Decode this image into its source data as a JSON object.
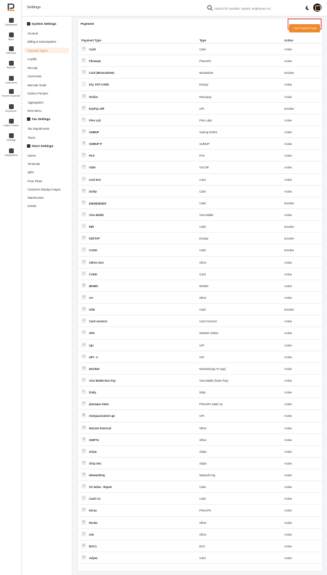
{
  "app": {
    "title": "Settings"
  },
  "rail": [
    {
      "icon": "dashboard-icon",
      "label": "Dashboard"
    },
    {
      "icon": "apps-icon",
      "label": "Apps"
    },
    {
      "icon": "inventory-icon",
      "label": "Inventory"
    },
    {
      "icon": "reports-icon",
      "label": "Reports"
    },
    {
      "icon": "customers-icon",
      "label": "Customers"
    },
    {
      "icon": "income-expense-icon",
      "label": "Income Expense"
    },
    {
      "icon": "employee-icon",
      "label": "Employee"
    },
    {
      "icon": "online-orders-icon",
      "label": "Online Orders"
    },
    {
      "icon": "settings-icon",
      "label": "Settings"
    },
    {
      "icon": "integrations-icon",
      "label": "Integrations"
    }
  ],
  "search": {
    "placeholder": "Search for modules, reports, employees etc..."
  },
  "menu": {
    "system_title": "System Settings",
    "system_items": [
      "General",
      "Billing & Subscriptions",
      "Payment Types",
      "Loyalty",
      "Receipt",
      "Currencies",
      "Barcode Scale",
      "Kitchen Printers",
      "Aggregators",
      "Item Menu"
    ],
    "tax_title": "Tax Settings",
    "tax_items": [
      "Tax Departments",
      "Taxes"
    ],
    "store_title": "Store Settings",
    "store_items": [
      "Stores",
      "Terminals",
      "QDS",
      "Floor Plans",
      "Customer Display Images",
      "Warehouses",
      "KIOSK"
    ]
  },
  "panel": {
    "title": "Payment",
    "add_button": "+ Add Payment Type",
    "columns": [
      "Payment Type",
      "Type",
      "Active"
    ]
  },
  "rows": [
    {
      "badge": "C",
      "name": "Cash",
      "type": "Cash",
      "active": "Active"
    },
    {
      "badge": "P",
      "name": "Phonepe",
      "type": "PhonePe",
      "active": "Active"
    },
    {
      "badge": "C",
      "name": "Card (Mossambee)",
      "type": "Mosambee",
      "active": "Inactive"
    },
    {
      "badge": "",
      "name": "Ezy TAP CARD",
      "type": "Ezetap",
      "active": "Active"
    },
    {
      "badge": "O",
      "name": "Online",
      "type": "Razorpay",
      "active": "Active"
    },
    {
      "badge": "E",
      "name": "EzyPay UPI",
      "type": "UPI",
      "active": "Inactive"
    },
    {
      "badge": "P",
      "name": "Pine Lab",
      "type": "Pine Labs",
      "active": "Active"
    },
    {
      "badge": "S",
      "name": "SUMUP",
      "type": "Sumup Online",
      "active": "Active"
    },
    {
      "badge": "S",
      "name": "SUMUP P",
      "type": "SUMUP",
      "active": "Active"
    },
    {
      "badge": "P",
      "name": "PAX",
      "type": "PAX",
      "active": "Active"
    },
    {
      "badge": "V",
      "name": "Valor",
      "type": "VALOR",
      "active": "Active"
    },
    {
      "badge": "C",
      "name": "card test",
      "type": "Card",
      "active": "Active"
    },
    {
      "badge": "D",
      "name": "Dollar",
      "type": "Cash",
      "active": "Active"
    },
    {
      "badge": "P",
      "name": "pppppppppp",
      "type": "Cash",
      "active": "Inactive"
    },
    {
      "badge": "V",
      "name": "Viva Wallet",
      "type": "Viva Wallet",
      "active": "Active"
    },
    {
      "badge": "I",
      "name": "INR",
      "type": "Cash",
      "active": "Inactive"
    },
    {
      "badge": "E",
      "name": "EZETAP",
      "type": "Ezetap",
      "active": "Inactive"
    },
    {
      "badge": "C",
      "name": "CASH",
      "type": "Cash",
      "active": "Inactive"
    },
    {
      "badge": "O",
      "name": "others test",
      "type": "Other",
      "active": "Active"
    },
    {
      "badge": "C",
      "name": "CARD",
      "type": "Card",
      "active": "Active"
    },
    {
      "badge": "M",
      "name": "MOMO",
      "type": "MOMO",
      "active": "Active"
    },
    {
      "badge": "R",
      "name": "rrrr",
      "type": "Other",
      "active": "Active"
    },
    {
      "badge": "U",
      "name": "USD",
      "type": "Cash",
      "active": "Inactive"
    },
    {
      "badge": "C",
      "name": "Card connect",
      "type": "Card Connect",
      "active": "Active"
    },
    {
      "badge": "U",
      "name": "UPA",
      "type": "NexiNet Online",
      "active": "Active"
    },
    {
      "badge": "U",
      "name": "Upi",
      "type": "UPI",
      "active": "Active"
    },
    {
      "badge": "U",
      "name": "UPI - 2",
      "type": "UPI",
      "active": "Active"
    },
    {
      "badge": "N",
      "name": "NexiNet",
      "type": "NexiNet(App To App)",
      "active": "Active"
    },
    {
      "badge": "V",
      "name": "Viva Wallet Nox Pay",
      "type": "Viva Wallet (Nose Pay)",
      "active": "Active"
    },
    {
      "badge": "L",
      "name": "linkly",
      "type": "linkly",
      "active": "Active"
    },
    {
      "badge": "P",
      "name": "phonepe static",
      "type": "PhonePe Static Qr",
      "active": "Active"
    },
    {
      "badge": "M",
      "name": "mnepaarsiutest upi",
      "type": "UPI",
      "active": "Active"
    },
    {
      "badge": "N",
      "name": "Nexinet External",
      "type": "Other",
      "active": "Active"
    },
    {
      "badge": "S",
      "name": "SHIFT4",
      "type": "Other",
      "active": "Active"
    },
    {
      "badge": "S",
      "name": "stripe",
      "type": "Stripe",
      "active": "Active"
    },
    {
      "badge": "S",
      "name": "Strip test",
      "type": "Stripe",
      "active": "Active"
    },
    {
      "badge": "N",
      "name": "NetworkPay",
      "type": "Network Pay",
      "active": "Active"
    },
    {
      "badge": "S",
      "name": "Sri lanka - Rupee",
      "type": "Cash",
      "active": "Active"
    },
    {
      "badge": "C",
      "name": "Cash C3",
      "type": "Cash",
      "active": "Active"
    },
    {
      "badge": "K",
      "name": "Klova",
      "type": "PhonePe",
      "active": "Active"
    },
    {
      "badge": "R",
      "name": "Rocks",
      "type": "Other",
      "active": "Active"
    },
    {
      "badge": "V",
      "name": "vdv",
      "type": "Other",
      "active": "Active"
    },
    {
      "badge": "B",
      "name": "BAC1",
      "type": "BAC",
      "active": "Active"
    },
    {
      "badge": "A",
      "name": "Adyen",
      "type": "Card",
      "active": "Active"
    }
  ],
  "colors": {
    "accent": "#ef8a2d",
    "highlight_border": "#e03a2f",
    "active_menu_bg": "#fdf0e6"
  }
}
